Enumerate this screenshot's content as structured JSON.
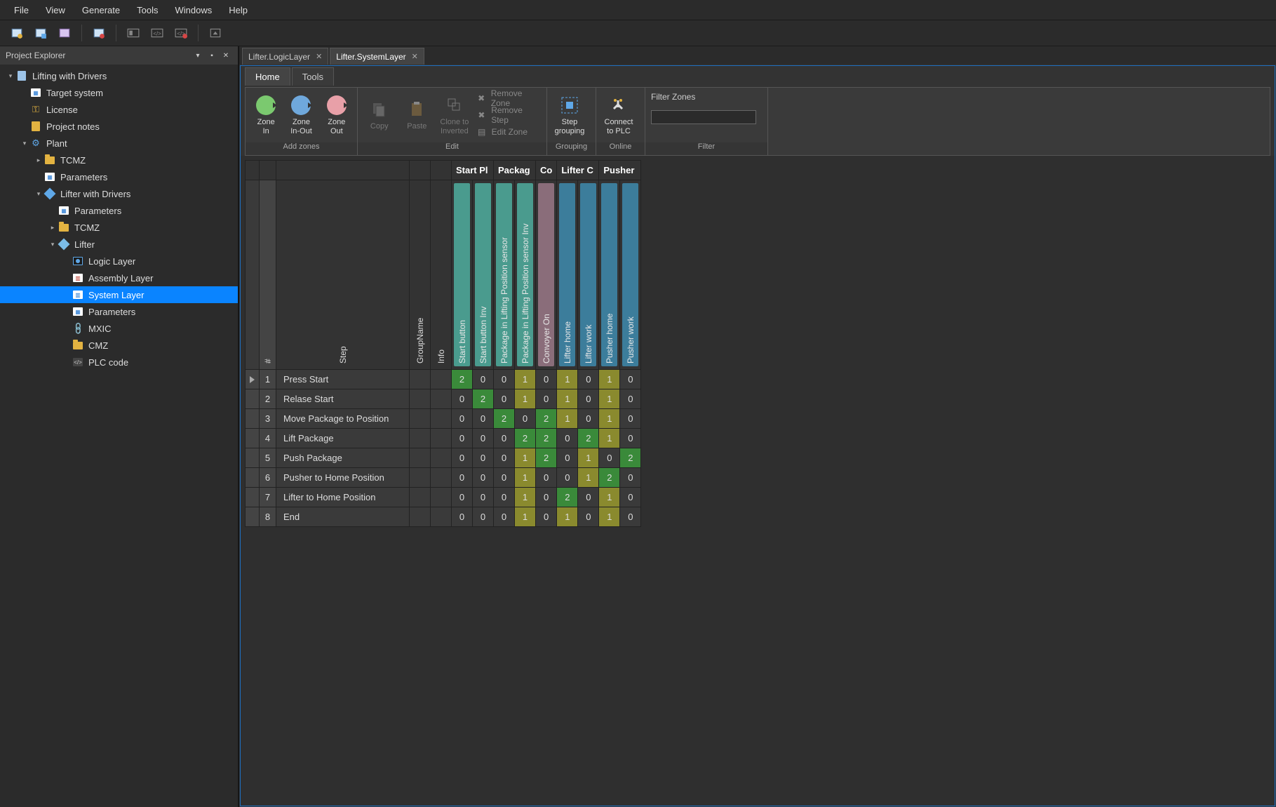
{
  "menubar": [
    "File",
    "View",
    "Generate",
    "Tools",
    "Windows",
    "Help"
  ],
  "explorer": {
    "title": "Project Explorer",
    "tree": [
      {
        "d": 0,
        "tw": "▾",
        "ic": "doc",
        "label": "Lifting with Drivers"
      },
      {
        "d": 1,
        "tw": "",
        "ic": "param",
        "label": "Target system"
      },
      {
        "d": 1,
        "tw": "",
        "ic": "key",
        "label": "License"
      },
      {
        "d": 1,
        "tw": "",
        "ic": "note",
        "label": "Project notes"
      },
      {
        "d": 1,
        "tw": "▾",
        "ic": "gear",
        "label": "Plant"
      },
      {
        "d": 2,
        "tw": "▸",
        "ic": "folder",
        "label": "TCMZ"
      },
      {
        "d": 2,
        "tw": "",
        "ic": "param",
        "label": "Parameters"
      },
      {
        "d": 2,
        "tw": "▾",
        "ic": "cube",
        "label": "Lifter with Drivers"
      },
      {
        "d": 3,
        "tw": "",
        "ic": "param",
        "label": "Parameters"
      },
      {
        "d": 3,
        "tw": "▸",
        "ic": "folder",
        "label": "TCMZ"
      },
      {
        "d": 3,
        "tw": "▾",
        "ic": "cubelt",
        "label": "Lifter"
      },
      {
        "d": 4,
        "tw": "",
        "ic": "logic",
        "label": "Logic Layer"
      },
      {
        "d": 4,
        "tw": "",
        "ic": "asm",
        "label": "Assembly Layer"
      },
      {
        "d": 4,
        "tw": "",
        "ic": "sys",
        "label": "System Layer",
        "sel": true
      },
      {
        "d": 4,
        "tw": "",
        "ic": "param",
        "label": "Parameters"
      },
      {
        "d": 4,
        "tw": "",
        "ic": "link",
        "label": "MXIC"
      },
      {
        "d": 4,
        "tw": "",
        "ic": "folder",
        "label": "CMZ"
      },
      {
        "d": 4,
        "tw": "",
        "ic": "code",
        "label": "PLC code"
      }
    ]
  },
  "docTabs": [
    {
      "label": "Lifter.LogicLayer",
      "active": false
    },
    {
      "label": "Lifter.SystemLayer",
      "active": true
    }
  ],
  "ribbonTabs": [
    {
      "label": "Home",
      "active": true
    },
    {
      "label": "Tools",
      "active": false
    }
  ],
  "ribbon": {
    "addZones": {
      "groupLabel": "Add zones",
      "zoneIn": "Zone\nIn",
      "zoneInOut": "Zone\nIn-Out",
      "zoneOut": "Zone\nOut"
    },
    "edit": {
      "groupLabel": "Edit",
      "copy": "Copy",
      "paste": "Paste",
      "cloneInv": "Clone to\nInverted",
      "removeZone": "Remove Zone",
      "removeStep": "Remove Step",
      "editZone": "Edit Zone"
    },
    "grouping": {
      "groupLabel": "Grouping",
      "stepGrouping": "Step\ngrouping"
    },
    "online": {
      "groupLabel": "Online",
      "connect": "Connect\nto PLC"
    },
    "filter": {
      "groupLabel": "Filter",
      "filterZones": "Filter Zones"
    }
  },
  "grid": {
    "numHeader": "#",
    "stepHeader": "Step",
    "gnHeader": "GroupName",
    "infoHeader": "Info",
    "colGroups": [
      "Start Pl",
      "Packag",
      "Co",
      "Lifter C",
      "Pusher"
    ],
    "zoneColumns": [
      {
        "label": "Start button",
        "grp": 0,
        "color": "green"
      },
      {
        "label": "Start button Inv",
        "grp": 0,
        "color": "green"
      },
      {
        "label": "Package in Lifting Position sensor",
        "grp": 1,
        "color": "green"
      },
      {
        "label": "Package in Lifting Position sensor Inv",
        "grp": 1,
        "color": "green"
      },
      {
        "label": "Convoyer On",
        "grp": 2,
        "color": "mauve"
      },
      {
        "label": "Lifter home",
        "grp": 3,
        "color": "teal"
      },
      {
        "label": "Lifter work",
        "grp": 3,
        "color": "teal"
      },
      {
        "label": "Pusher home",
        "grp": 4,
        "color": "teal"
      },
      {
        "label": "Pusher work",
        "grp": 4,
        "color": "teal"
      }
    ],
    "rows": [
      {
        "marker": true,
        "n": 1,
        "step": "Press Start",
        "v": [
          2,
          0,
          0,
          1,
          0,
          1,
          0,
          1,
          0
        ]
      },
      {
        "n": 2,
        "step": "Relase Start",
        "v": [
          0,
          2,
          0,
          1,
          0,
          1,
          0,
          1,
          0
        ]
      },
      {
        "n": 3,
        "step": "Move Package to Position",
        "v": [
          0,
          0,
          2,
          0,
          2,
          1,
          0,
          1,
          0
        ]
      },
      {
        "n": 4,
        "step": "Lift Package",
        "v": [
          0,
          0,
          0,
          2,
          2,
          0,
          2,
          1,
          0
        ]
      },
      {
        "n": 5,
        "step": "Push Package",
        "v": [
          0,
          0,
          0,
          1,
          2,
          0,
          1,
          0,
          2
        ]
      },
      {
        "n": 6,
        "step": "Pusher to Home Position",
        "v": [
          0,
          0,
          0,
          1,
          0,
          0,
          1,
          2,
          0
        ]
      },
      {
        "n": 7,
        "step": "Lifter to Home Position",
        "v": [
          0,
          0,
          0,
          1,
          0,
          2,
          0,
          1,
          0
        ]
      },
      {
        "n": 8,
        "step": "End",
        "v": [
          0,
          0,
          0,
          1,
          0,
          1,
          0,
          1,
          0
        ]
      }
    ]
  }
}
